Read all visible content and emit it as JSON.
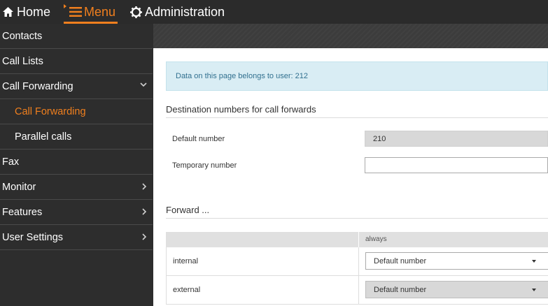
{
  "topbar": {
    "home_label": "Home",
    "menu_label": "Menu",
    "admin_label": "Administration",
    "accent_color": "#f07f1e"
  },
  "sidebar": {
    "items": [
      {
        "label": "Contacts"
      },
      {
        "label": "Call Lists"
      },
      {
        "label": "Call Forwarding",
        "expanded": true
      },
      {
        "label": "Call Forwarding",
        "active": true
      },
      {
        "label": "Parallel calls"
      },
      {
        "label": "Fax"
      },
      {
        "label": "Monitor"
      },
      {
        "label": "Features"
      },
      {
        "label": "User Settings"
      }
    ]
  },
  "main": {
    "info_text": "Data on this page belongs to user: 212",
    "destination_title": "Destination numbers for call forwards",
    "default_number_label": "Default number",
    "default_number_value": "210",
    "temporary_number_label": "Temporary number",
    "temporary_number_value": "",
    "forward_title": "Forward ...",
    "table": {
      "column_header": "always",
      "rows": [
        {
          "label": "internal",
          "value": "Default number"
        },
        {
          "label": "external",
          "value": "Default number"
        }
      ]
    }
  },
  "icons": {
    "home": "home-icon",
    "menu": "hamburger-icon",
    "admin": "gear-icon",
    "chevron_down": "chevron-down-icon",
    "chevron_right": "chevron-right-icon",
    "dropdown": "caret-down-icon"
  }
}
